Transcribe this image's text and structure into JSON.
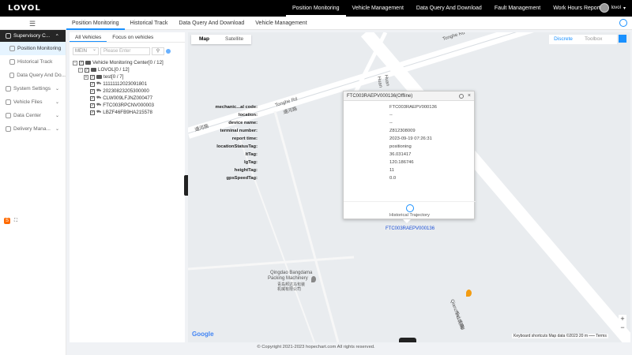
{
  "brand": "LOVOL",
  "topnav": {
    "items": [
      "Position Monitoring",
      "Vehicle Management",
      "Data Query And Download",
      "Fault Management",
      "Work Hours Report"
    ],
    "user": "lovol"
  },
  "subnav": {
    "items": [
      "Position Monitoring",
      "Historical Track",
      "Data Query And Download",
      "Vehicle Management"
    ]
  },
  "sidebar": {
    "head": "Supervisory C...",
    "items": [
      "Position Monitoring",
      "Historical Track",
      "Data Query And Do..."
    ],
    "groups": [
      "System Settings",
      "Vehicle Files",
      "Data Center",
      "Delivery Mana..."
    ]
  },
  "tree": {
    "tabs": [
      "All Vehicles",
      "Focus on vehicles"
    ],
    "select_value": "MEIN",
    "search_placeholder": "Please Enter",
    "nodes": [
      "Vehicle Monitoring Center[0 / 12]",
      "LOVOL[0 / 12]",
      "test[0 / 7]",
      "11111112023091801",
      "20230823205300000",
      "CLW009LFJNZ000477",
      "FTC003RPCNV000003",
      "LBZF46FB9HA215578"
    ]
  },
  "map": {
    "types": [
      "Map",
      "Satellite"
    ],
    "discrete": "Discrete",
    "toolbox": "Toolbox",
    "labels": {
      "road1": "Tonghe Rd",
      "road1_cn": "通河路",
      "road1b_cn": "通河路",
      "road2": "Tonghe Rd",
      "road3": "Huan",
      "road3b": "Huan",
      "road4": "Qianzhan S Rd",
      "road4_cn": "千山南路",
      "poi_name1": "Qingdao Bangdama",
      "poi_name2": "Packing Machinery",
      "poi_cn": "青岛邦达马包装",
      "poi_cn2": "机械有限公司"
    },
    "google": "Google",
    "attribution": "Keyboard shortcuts    Map data ©2023    20 m ⎯⎯⎯    Terms",
    "zoom_in": "+",
    "zoom_out": "−",
    "vehicle_label": "FTC003RAEPV000136"
  },
  "popup": {
    "title": "FTC003RAEPV000136(Offline)",
    "rows": [
      {
        "k": "mechanic...al code:",
        "v": "FTC003RAEPV000136"
      },
      {
        "k": "location:",
        "v": "--"
      },
      {
        "k": "device name:",
        "v": "--"
      },
      {
        "k": "terminal number:",
        "v": "Z812308009"
      },
      {
        "k": "report time:",
        "v": "2023-09-19 07:26:31"
      },
      {
        "k": "locationStatusTag:",
        "v": "positioning"
      },
      {
        "k": "ltTag:",
        "v": "36.031417"
      },
      {
        "k": "lgTag:",
        "v": "120.186746"
      },
      {
        "k": "heightTag:",
        "v": "11"
      },
      {
        "k": "gpsSpeedTag:",
        "v": "0.0"
      }
    ],
    "history": "Historical Trajectory"
  },
  "footer": "© Copyright 2021-2023 hopechart.com All rights reserved."
}
